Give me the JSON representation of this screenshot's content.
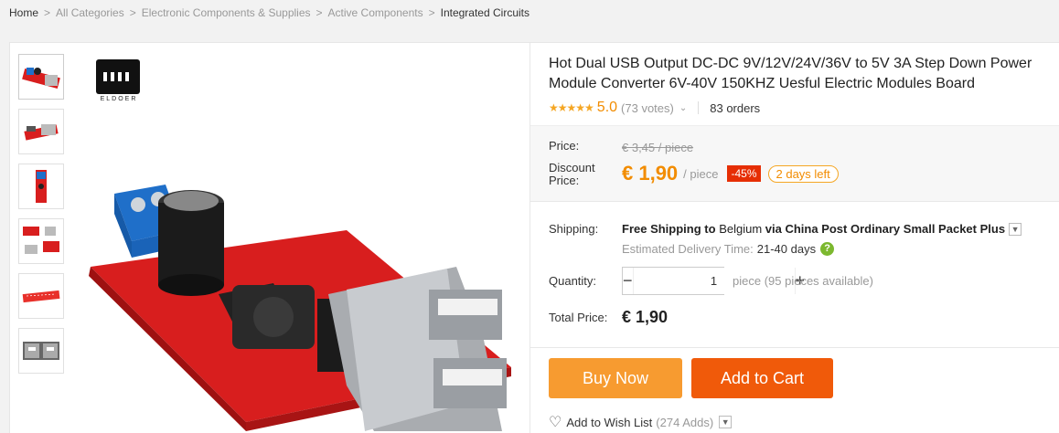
{
  "breadcrumb": {
    "items": [
      "Home",
      "All Categories",
      "Electronic Components & Supplies",
      "Active Components"
    ],
    "current": "Integrated Circuits",
    "separator": ">"
  },
  "brand": {
    "name": "ELDOER"
  },
  "product": {
    "title": "Hot Dual USB Output DC-DC 9V/12V/24V/36V to 5V 3A Step Down Power Module Converter 6V-40V 150KHZ Uesful Electric Modules Board",
    "stars": "★★★★★",
    "rating": "5.0",
    "votes": "(73 votes)",
    "orders": "83 orders"
  },
  "price": {
    "label": "Price:",
    "original": "€ 3,45 / piece",
    "discount_label": "Discount Price:",
    "discount_amount": "€ 1,90",
    "unit": "/ piece",
    "off": "-45%",
    "days_left": "2 days left"
  },
  "shipping": {
    "label": "Shipping:",
    "free_text": "Free Shipping to",
    "country": "Belgium",
    "via_text": "via China Post Ordinary Small Packet Plus",
    "est_label": "Estimated Delivery Time:",
    "est_days": "21-40 days",
    "help": "?"
  },
  "quantity": {
    "label": "Quantity:",
    "minus": "−",
    "plus": "+",
    "value": "1",
    "available": "piece (95 pieces available)"
  },
  "total": {
    "label": "Total Price:",
    "value": "€ 1,90"
  },
  "actions": {
    "buy_now": "Buy Now",
    "add_to_cart": "Add to Cart",
    "wishlist": "Add to Wish List",
    "wishlist_count": "(274 Adds)"
  },
  "colors": {
    "accent_orange": "#f28c00",
    "buy_button": "#f79b30",
    "cart_button": "#f05a0a",
    "discount_badge": "#e62e04",
    "star": "#f5a623"
  },
  "icons": [
    "chevron-down-icon",
    "help-icon",
    "heart-icon",
    "minus-icon",
    "plus-icon"
  ]
}
